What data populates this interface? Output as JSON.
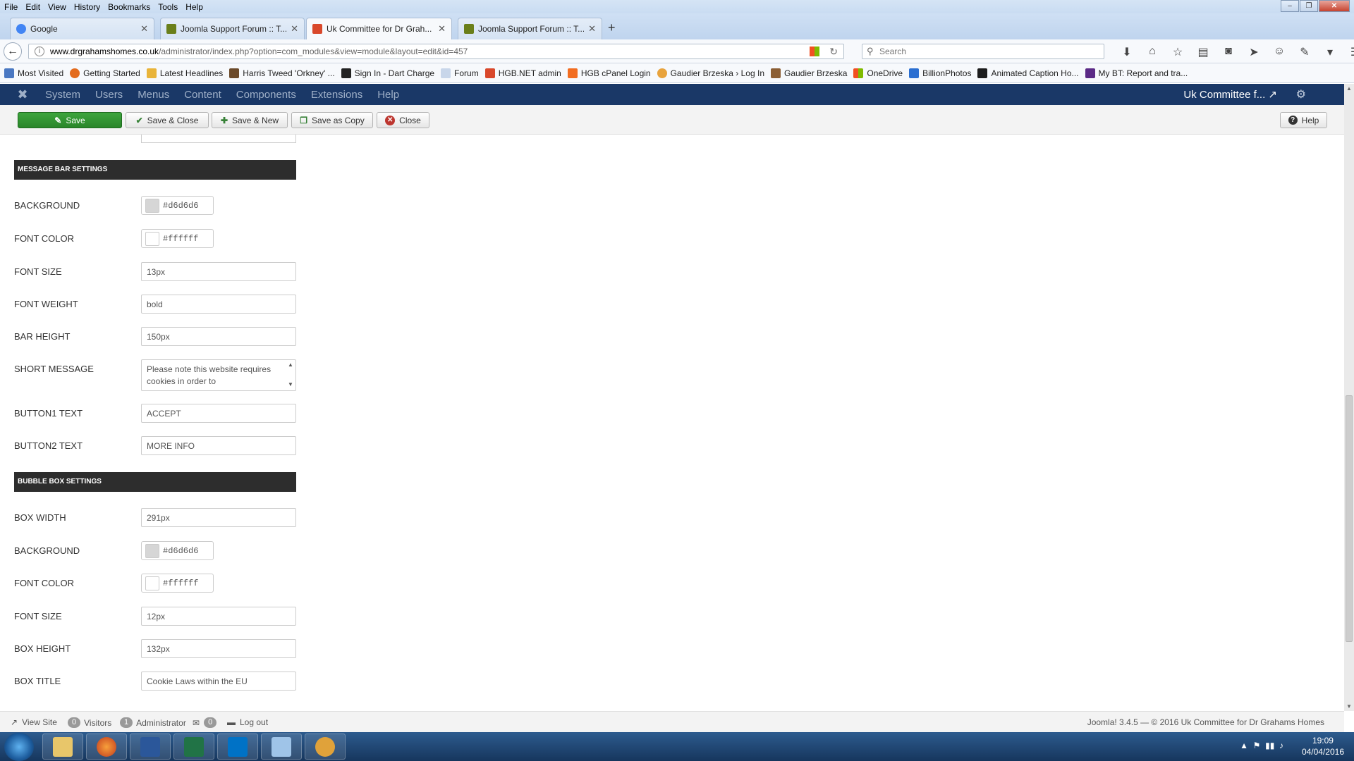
{
  "browser": {
    "menu": [
      "File",
      "Edit",
      "View",
      "History",
      "Bookmarks",
      "Tools",
      "Help"
    ],
    "tabs": [
      {
        "title": "Google",
        "color": "#4285f4"
      },
      {
        "title": "Joomla Support Forum :: T...",
        "color": "#6a7f1a"
      },
      {
        "title": "Uk Committee for Dr Grah...",
        "color": "#d9482b"
      },
      {
        "title": "Joomla Support Forum :: T...",
        "color": "#6a7f1a"
      }
    ],
    "url_domain": "www.drgrahamshomes.co.uk",
    "url_path": "/administrator/index.php?option=com_modules&view=module&layout=edit&id=457",
    "search_placeholder": "Search",
    "bookmarks": [
      "Most Visited",
      "Getting Started",
      "Latest Headlines",
      "Harris Tweed 'Orkney' ...",
      "Sign In - Dart Charge",
      "Forum",
      "HGB.NET admin",
      "HGB cPanel Login",
      "Gaudier Brzeska › Log In",
      "Gaudier Brzeska",
      "OneDrive",
      "BillionPhotos",
      "Animated Caption Ho...",
      "My BT: Report and tra..."
    ]
  },
  "joomla": {
    "nav": [
      "System",
      "Users",
      "Menus",
      "Content",
      "Components",
      "Extensions",
      "Help"
    ],
    "site_name": "Uk Committee f...",
    "toolbar": {
      "save": "Save",
      "save_close": "Save & Close",
      "save_new": "Save & New",
      "save_copy": "Save as Copy",
      "close": "Close",
      "help": "Help"
    },
    "message_bar": {
      "heading": "MESSAGE BAR SETTINGS",
      "background_label": "BACKGROUND",
      "background_value": "#d6d6d6",
      "font_color_label": "FONT COLOR",
      "font_color_value": "#ffffff",
      "font_size_label": "FONT SIZE",
      "font_size_value": "13px",
      "font_weight_label": "FONT WEIGHT",
      "font_weight_value": "bold",
      "bar_height_label": "BAR HEIGHT",
      "bar_height_value": "150px",
      "short_message_label": "SHORT MESSAGE",
      "short_message_value": "Please note this website requires cookies in order to",
      "button1_label": "BUTTON1 TEXT",
      "button1_value": "ACCEPT",
      "button2_label": "BUTTON2 TEXT",
      "button2_value": "MORE INFO"
    },
    "bubble_box": {
      "heading": "BUBBLE BOX SETTINGS",
      "box_width_label": "BOX WIDTH",
      "box_width_value": "291px",
      "background_label": "BACKGROUND",
      "background_value": "#d6d6d6",
      "font_color_label": "FONT COLOR",
      "font_color_value": "#ffffff",
      "font_size_label": "FONT SIZE",
      "font_size_value": "12px",
      "box_height_label": "BOX HEIGHT",
      "box_height_value": "132px",
      "box_title_label": "BOX TITLE",
      "box_title_value": "Cookie Laws within the EU"
    },
    "status": {
      "view_site": "View Site",
      "visitors_count": "0",
      "visitors": "Visitors",
      "admin_count": "1",
      "administrator": "Administrator",
      "messages_count": "0",
      "logout": "Log out",
      "copyright": "Joomla! 3.4.5 — © 2016 Uk Committee for Dr Grahams Homes"
    }
  },
  "taskbar": {
    "time": "19:09",
    "date": "04/04/2016"
  }
}
